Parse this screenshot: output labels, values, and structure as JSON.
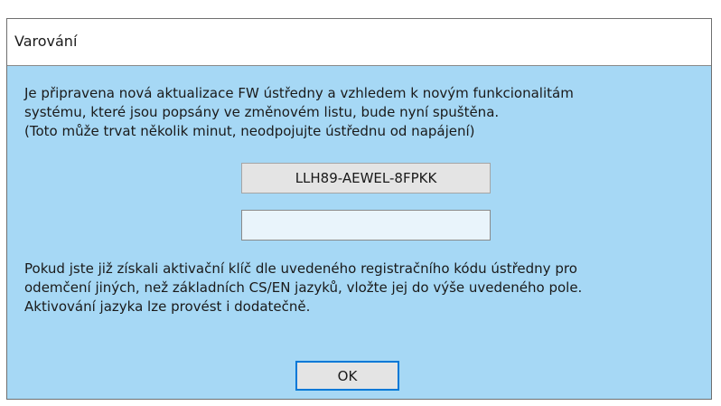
{
  "dialog": {
    "title": "Varování",
    "message": "Je připravena nová aktualizace FW ústředny a vzhledem k novým funkcionalitám\nsystému, které jsou popsány ve změnovém listu, bude nyní spuštěna.\n(Toto může trvat několik minut, neodpojujte ústřednu od napájení)",
    "registration_code": "LLH89-AEWEL-8FPKK",
    "activation_key_value": "",
    "activation_message": "Pokud jste již získali aktivační klíč dle uvedeného registračního kódu ústředny pro\nodemčení jiných, než základních CS/EN jazyků, vložte jej do výše uvedeného pole.\nAktivování jazyka lze provést i dodatečně.",
    "ok_label": "OK"
  },
  "colors": {
    "dialog_background": "#a6d8f5",
    "titlebar_background": "#ffffff",
    "button_focus_border": "#0078d7"
  }
}
